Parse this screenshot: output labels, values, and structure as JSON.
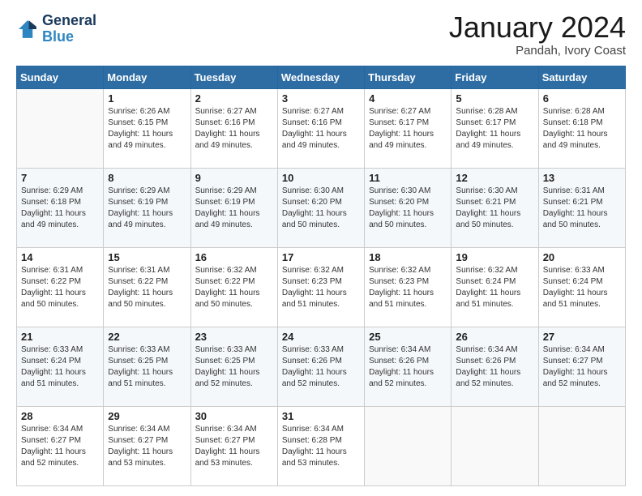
{
  "header": {
    "logo_line1": "General",
    "logo_line2": "Blue",
    "month": "January 2024",
    "location": "Pandah, Ivory Coast"
  },
  "weekdays": [
    "Sunday",
    "Monday",
    "Tuesday",
    "Wednesday",
    "Thursday",
    "Friday",
    "Saturday"
  ],
  "weeks": [
    [
      {
        "day": "",
        "info": ""
      },
      {
        "day": "1",
        "info": "Sunrise: 6:26 AM\nSunset: 6:15 PM\nDaylight: 11 hours\nand 49 minutes."
      },
      {
        "day": "2",
        "info": "Sunrise: 6:27 AM\nSunset: 6:16 PM\nDaylight: 11 hours\nand 49 minutes."
      },
      {
        "day": "3",
        "info": "Sunrise: 6:27 AM\nSunset: 6:16 PM\nDaylight: 11 hours\nand 49 minutes."
      },
      {
        "day": "4",
        "info": "Sunrise: 6:27 AM\nSunset: 6:17 PM\nDaylight: 11 hours\nand 49 minutes."
      },
      {
        "day": "5",
        "info": "Sunrise: 6:28 AM\nSunset: 6:17 PM\nDaylight: 11 hours\nand 49 minutes."
      },
      {
        "day": "6",
        "info": "Sunrise: 6:28 AM\nSunset: 6:18 PM\nDaylight: 11 hours\nand 49 minutes."
      }
    ],
    [
      {
        "day": "7",
        "info": "Sunrise: 6:29 AM\nSunset: 6:18 PM\nDaylight: 11 hours\nand 49 minutes."
      },
      {
        "day": "8",
        "info": "Sunrise: 6:29 AM\nSunset: 6:19 PM\nDaylight: 11 hours\nand 49 minutes."
      },
      {
        "day": "9",
        "info": "Sunrise: 6:29 AM\nSunset: 6:19 PM\nDaylight: 11 hours\nand 49 minutes."
      },
      {
        "day": "10",
        "info": "Sunrise: 6:30 AM\nSunset: 6:20 PM\nDaylight: 11 hours\nand 50 minutes."
      },
      {
        "day": "11",
        "info": "Sunrise: 6:30 AM\nSunset: 6:20 PM\nDaylight: 11 hours\nand 50 minutes."
      },
      {
        "day": "12",
        "info": "Sunrise: 6:30 AM\nSunset: 6:21 PM\nDaylight: 11 hours\nand 50 minutes."
      },
      {
        "day": "13",
        "info": "Sunrise: 6:31 AM\nSunset: 6:21 PM\nDaylight: 11 hours\nand 50 minutes."
      }
    ],
    [
      {
        "day": "14",
        "info": "Sunrise: 6:31 AM\nSunset: 6:22 PM\nDaylight: 11 hours\nand 50 minutes."
      },
      {
        "day": "15",
        "info": "Sunrise: 6:31 AM\nSunset: 6:22 PM\nDaylight: 11 hours\nand 50 minutes."
      },
      {
        "day": "16",
        "info": "Sunrise: 6:32 AM\nSunset: 6:22 PM\nDaylight: 11 hours\nand 50 minutes."
      },
      {
        "day": "17",
        "info": "Sunrise: 6:32 AM\nSunset: 6:23 PM\nDaylight: 11 hours\nand 51 minutes."
      },
      {
        "day": "18",
        "info": "Sunrise: 6:32 AM\nSunset: 6:23 PM\nDaylight: 11 hours\nand 51 minutes."
      },
      {
        "day": "19",
        "info": "Sunrise: 6:32 AM\nSunset: 6:24 PM\nDaylight: 11 hours\nand 51 minutes."
      },
      {
        "day": "20",
        "info": "Sunrise: 6:33 AM\nSunset: 6:24 PM\nDaylight: 11 hours\nand 51 minutes."
      }
    ],
    [
      {
        "day": "21",
        "info": "Sunrise: 6:33 AM\nSunset: 6:24 PM\nDaylight: 11 hours\nand 51 minutes."
      },
      {
        "day": "22",
        "info": "Sunrise: 6:33 AM\nSunset: 6:25 PM\nDaylight: 11 hours\nand 51 minutes."
      },
      {
        "day": "23",
        "info": "Sunrise: 6:33 AM\nSunset: 6:25 PM\nDaylight: 11 hours\nand 52 minutes."
      },
      {
        "day": "24",
        "info": "Sunrise: 6:33 AM\nSunset: 6:26 PM\nDaylight: 11 hours\nand 52 minutes."
      },
      {
        "day": "25",
        "info": "Sunrise: 6:34 AM\nSunset: 6:26 PM\nDaylight: 11 hours\nand 52 minutes."
      },
      {
        "day": "26",
        "info": "Sunrise: 6:34 AM\nSunset: 6:26 PM\nDaylight: 11 hours\nand 52 minutes."
      },
      {
        "day": "27",
        "info": "Sunrise: 6:34 AM\nSunset: 6:27 PM\nDaylight: 11 hours\nand 52 minutes."
      }
    ],
    [
      {
        "day": "28",
        "info": "Sunrise: 6:34 AM\nSunset: 6:27 PM\nDaylight: 11 hours\nand 52 minutes."
      },
      {
        "day": "29",
        "info": "Sunrise: 6:34 AM\nSunset: 6:27 PM\nDaylight: 11 hours\nand 53 minutes."
      },
      {
        "day": "30",
        "info": "Sunrise: 6:34 AM\nSunset: 6:27 PM\nDaylight: 11 hours\nand 53 minutes."
      },
      {
        "day": "31",
        "info": "Sunrise: 6:34 AM\nSunset: 6:28 PM\nDaylight: 11 hours\nand 53 minutes."
      },
      {
        "day": "",
        "info": ""
      },
      {
        "day": "",
        "info": ""
      },
      {
        "day": "",
        "info": ""
      }
    ]
  ]
}
